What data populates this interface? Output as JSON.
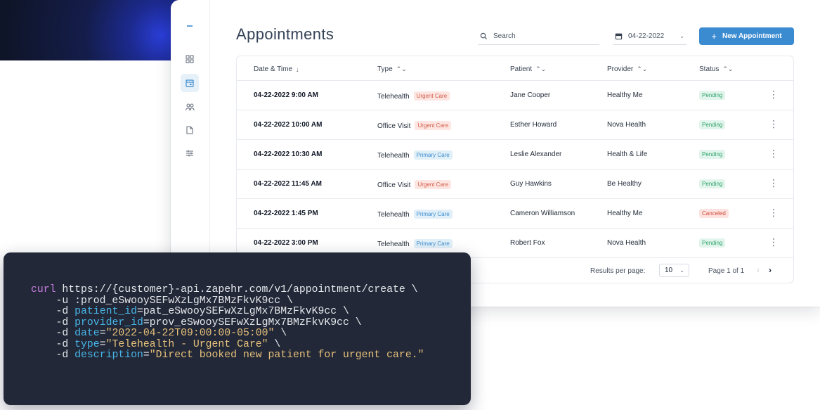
{
  "page": {
    "title": "Appointments"
  },
  "search": {
    "placeholder": "Search"
  },
  "date_filter": {
    "value": "04-22-2022"
  },
  "new_button": {
    "icon": "plus-icon",
    "label": "New Appointment",
    "color": "#3b8bd0"
  },
  "sidebar": {
    "items": [
      {
        "name": "menu",
        "icon": "menu-icon"
      },
      {
        "name": "dashboard",
        "icon": "grid-icon"
      },
      {
        "name": "appointments",
        "icon": "calendar-icon",
        "active": true
      },
      {
        "name": "patients",
        "icon": "users-icon"
      },
      {
        "name": "documents",
        "icon": "document-icon"
      },
      {
        "name": "settings",
        "icon": "sliders-icon"
      }
    ]
  },
  "table": {
    "columns": [
      {
        "label": "Date & Time",
        "sort": "↓"
      },
      {
        "label": "Type",
        "sort": "⌃⌄"
      },
      {
        "label": "Patient",
        "sort": "⌃⌄"
      },
      {
        "label": "Provider",
        "sort": "⌃⌄"
      },
      {
        "label": "Status",
        "sort": "⌃⌄"
      }
    ],
    "rows": [
      {
        "datetime": "04-22-2022 9:00 AM",
        "type": "Telehealth",
        "tag": "Urgent Care",
        "tag_kind": "urgent",
        "patient": "Jane Cooper",
        "provider": "Healthy Me",
        "status": "Pending",
        "status_kind": "pending",
        "more": "⋮"
      },
      {
        "datetime": "04-22-2022 10:00 AM",
        "type": "Office Visit",
        "tag": "Urgent Care",
        "tag_kind": "urgent",
        "patient": "Esther Howard",
        "provider": "Nova Health",
        "status": "Pending",
        "status_kind": "pending",
        "more": "⋮"
      },
      {
        "datetime": "04-22-2022 10:30 AM",
        "type": "Telehealth",
        "tag": "Primary Care",
        "tag_kind": "primary",
        "patient": "Leslie Alexander",
        "provider": "Health & Life",
        "status": "Pending",
        "status_kind": "pending",
        "more": "⋮"
      },
      {
        "datetime": "04-22-2022 11:45 AM",
        "type": "Office Visit",
        "tag": "Urgent Care",
        "tag_kind": "urgent",
        "patient": "Guy Hawkins",
        "provider": "Be Healthy",
        "status": "Pending",
        "status_kind": "pending",
        "more": "⋮"
      },
      {
        "datetime": "04-22-2022 1:45 PM",
        "type": "Telehealth",
        "tag": "Primary Care",
        "tag_kind": "primary",
        "patient": "Cameron Williamson",
        "provider": "Healthy Me",
        "status": "Canceled",
        "status_kind": "canceled",
        "more": "⋮"
      },
      {
        "datetime": "04-22-2022 3:00 PM",
        "type": "Telehealth",
        "tag": "Primary Care",
        "tag_kind": "primary",
        "patient": "Robert Fox",
        "provider": "Nova Health",
        "status": "Pending",
        "status_kind": "pending",
        "more": "⋮"
      }
    ]
  },
  "pagination": {
    "results_label": "Results per page:",
    "per_page": "10",
    "page_info": "Page 1 of 1",
    "prev": "‹",
    "next": "›"
  },
  "code_snippet": {
    "lines": [
      [
        {
          "t": "curl",
          "c": "kw"
        },
        {
          "t": " https://{customer}-api.zapehr.com/v1/appointment/create \\"
        }
      ],
      [
        {
          "t": "    -u :prod_eSwooySEFwXzLgMx7BMzFkvK9cc \\"
        }
      ],
      [
        {
          "t": "    -d "
        },
        {
          "t": "patient_id",
          "c": "key"
        },
        {
          "t": "=pat_eSwooySEFwXzLgMx7BMzFkvK9cc \\"
        }
      ],
      [
        {
          "t": "    -d "
        },
        {
          "t": "provider_id",
          "c": "key"
        },
        {
          "t": "=prov_eSwooySEFwXzLgMx7BMzFkvK9cc \\"
        }
      ],
      [
        {
          "t": "    -d "
        },
        {
          "t": "date",
          "c": "key"
        },
        {
          "t": "="
        },
        {
          "t": "\"2022-04-22T09:00:00-05:00\"",
          "c": "str"
        },
        {
          "t": " \\"
        }
      ],
      [
        {
          "t": "    -d "
        },
        {
          "t": "type",
          "c": "key"
        },
        {
          "t": "="
        },
        {
          "t": "\"Telehealth - Urgent Care\"",
          "c": "str"
        },
        {
          "t": " \\"
        }
      ],
      [
        {
          "t": "    -d "
        },
        {
          "t": "description",
          "c": "key"
        },
        {
          "t": "="
        },
        {
          "t": "\"Direct booked new patient for urgent care.\"",
          "c": "str"
        }
      ]
    ]
  },
  "colors": {
    "accent": "#3b8bd0",
    "urgent_tag": "#d35b48",
    "primary_tag": "#3b8bd0",
    "pending": "#2fa36b",
    "canceled": "#d24a3a",
    "code_bg": "#222837"
  }
}
